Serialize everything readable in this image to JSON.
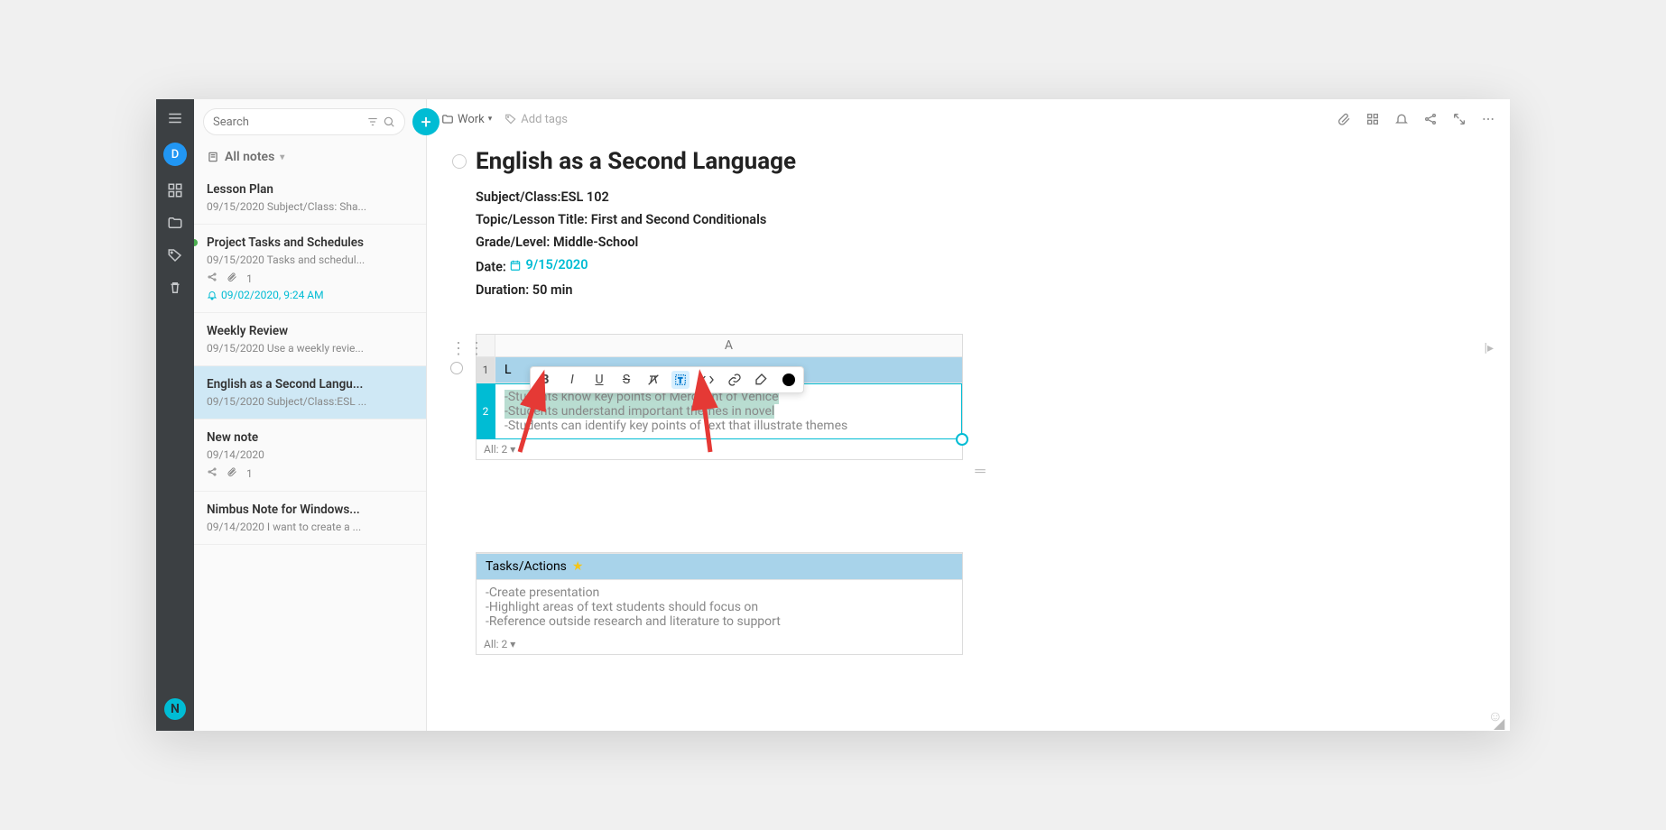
{
  "rail": {
    "avatar_letter": "D"
  },
  "search": {
    "placeholder": "Search"
  },
  "all_notes_label": "All notes",
  "notes": [
    {
      "title": "Lesson Plan",
      "sub": "09/15/2020 Subject/Class: Sha..."
    },
    {
      "title": "Project Tasks and Schedules",
      "sub": "09/15/2020 Tasks and schedul...",
      "attach": "1",
      "reminder": "09/02/2020, 9:24 AM",
      "green": true
    },
    {
      "title": "Weekly Review",
      "sub": "09/15/2020 Use a weekly revie..."
    },
    {
      "title": "English as a Second Langu...",
      "sub": "09/15/2020 Subject/Class:ESL ...",
      "active": true
    },
    {
      "title": "New note",
      "sub": "09/14/2020",
      "attach": "1",
      "share": true
    },
    {
      "title": "Nimbus Note for Windows...",
      "sub": "09/14/2020 I want to create a ..."
    }
  ],
  "crumb": {
    "folder": "Work"
  },
  "addtags": "Add tags",
  "doc": {
    "title": "English as a Second Language",
    "meta": {
      "subject_label": "Subject/Class:",
      "subject_val": "ESL 102",
      "topic_label": "Topic/Lesson Title:",
      "topic_val": " First and Second Conditionals",
      "grade_label": "Grade/Level:",
      "grade_val": " Middle-School",
      "date_label": "Date:",
      "date_val": "9/15/2020",
      "dur_label": "Duration:",
      "dur_val": " 50 min"
    }
  },
  "table1": {
    "col": "A",
    "row1": "L",
    "cell2": {
      "l1": "-Students know key points of Merchant of Venice",
      "l2": "-Students understand important themes in novel",
      "l3": "-Students can identify key points of text that illustrate themes"
    },
    "count": "All: 2"
  },
  "table2": {
    "row1": "Tasks/Actions",
    "cell2": {
      "l1": "-Create presentation",
      "l2": "-Highlight areas of text students should focus on",
      "l3": "-Reference outside research and literature to support"
    },
    "count": "All: 2"
  },
  "toolbar": {
    "b": "B",
    "i": "I",
    "u": "U",
    "s": "S"
  }
}
